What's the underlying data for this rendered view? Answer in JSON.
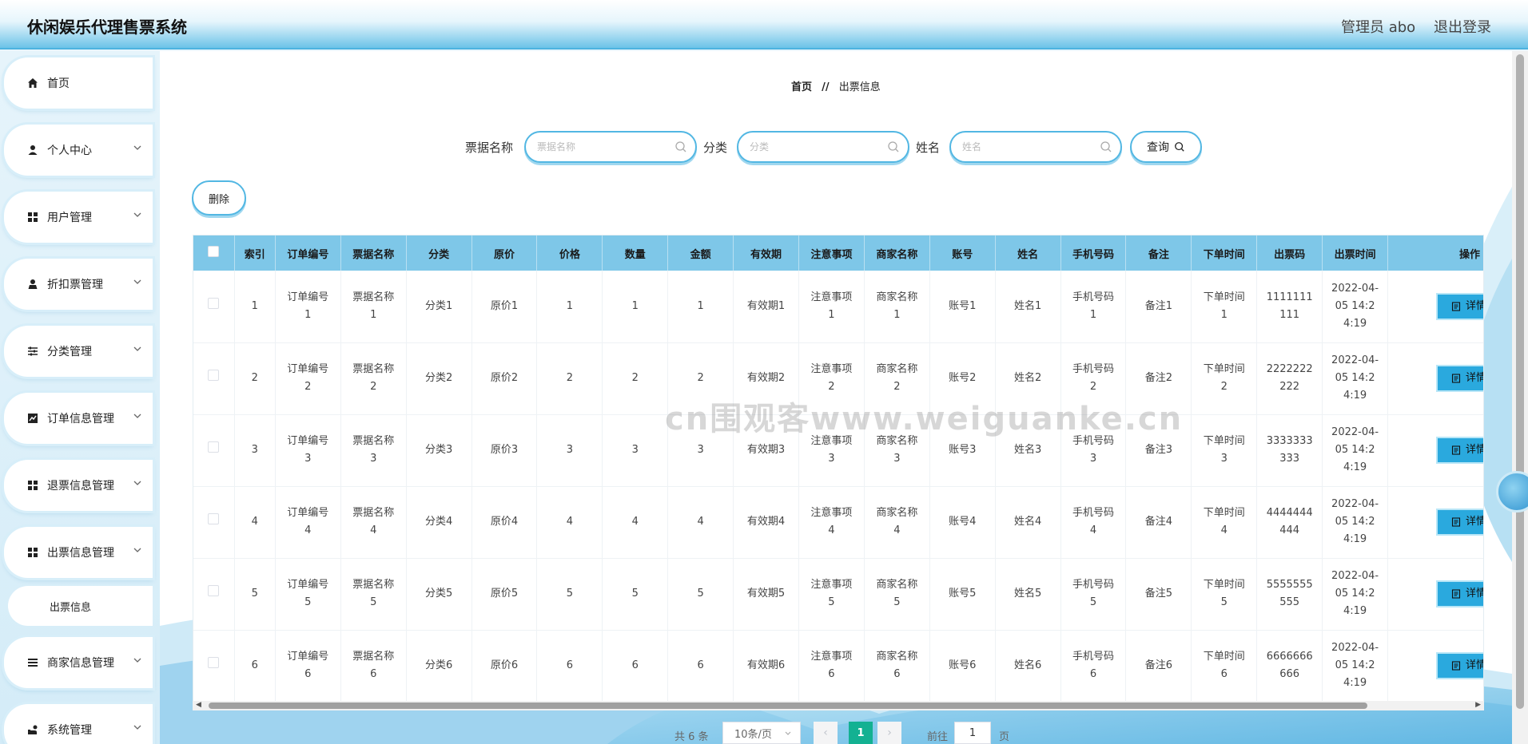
{
  "header": {
    "title": "休闲娱乐代理售票系统",
    "admin": "管理员 abo",
    "logout": "退出登录"
  },
  "sidebar": {
    "items": [
      {
        "label": "首页",
        "icon": "home-icon"
      },
      {
        "label": "个人中心",
        "icon": "user-icon"
      },
      {
        "label": "用户管理",
        "icon": "grid-icon"
      },
      {
        "label": "折扣票管理",
        "icon": "user-tie-icon"
      },
      {
        "label": "分类管理",
        "icon": "sliders-icon"
      },
      {
        "label": "订单信息管理",
        "icon": "chart-icon"
      },
      {
        "label": "退票信息管理",
        "icon": "grid-icon"
      },
      {
        "label": "出票信息管理",
        "icon": "grid-icon"
      },
      {
        "label": "商家信息管理",
        "icon": "list-icon"
      },
      {
        "label": "系统管理",
        "icon": "settings-hand-icon"
      }
    ],
    "submenu": {
      "label": "出票信息"
    }
  },
  "breadcrumb": {
    "home": "首页",
    "separator": "//",
    "current": "出票信息"
  },
  "search": {
    "ticket_label": "票据名称",
    "ticket_placeholder": "票据名称",
    "category_label": "分类",
    "category_placeholder": "分类",
    "name_label": "姓名",
    "name_placeholder": "姓名",
    "query_label": "查询"
  },
  "actions": {
    "delete_label": "删除",
    "detail_label": "详情"
  },
  "table": {
    "columns": [
      "索引",
      "订单编号",
      "票据名称",
      "分类",
      "原价",
      "价格",
      "数量",
      "金额",
      "有效期",
      "注意事项",
      "商家名称",
      "账号",
      "姓名",
      "手机号码",
      "备注",
      "下单时间",
      "出票码",
      "出票时间",
      "操作"
    ],
    "rows": [
      [
        "1",
        "订单编号1",
        "票据名称1",
        "分类1",
        "原价1",
        "1",
        "1",
        "1",
        "有效期1",
        "注意事项1",
        "商家名称1",
        "账号1",
        "姓名1",
        "手机号码1",
        "备注1",
        "下单时间1",
        "1111111111",
        "2022-04-05 14:24:19"
      ],
      [
        "2",
        "订单编号2",
        "票据名称2",
        "分类2",
        "原价2",
        "2",
        "2",
        "2",
        "有效期2",
        "注意事项2",
        "商家名称2",
        "账号2",
        "姓名2",
        "手机号码2",
        "备注2",
        "下单时间2",
        "2222222222",
        "2022-04-05 14:24:19"
      ],
      [
        "3",
        "订单编号3",
        "票据名称3",
        "分类3",
        "原价3",
        "3",
        "3",
        "3",
        "有效期3",
        "注意事项3",
        "商家名称3",
        "账号3",
        "姓名3",
        "手机号码3",
        "备注3",
        "下单时间3",
        "3333333333",
        "2022-04-05 14:24:19"
      ],
      [
        "4",
        "订单编号4",
        "票据名称4",
        "分类4",
        "原价4",
        "4",
        "4",
        "4",
        "有效期4",
        "注意事项4",
        "商家名称4",
        "账号4",
        "姓名4",
        "手机号码4",
        "备注4",
        "下单时间4",
        "4444444444",
        "2022-04-05 14:24:19"
      ],
      [
        "5",
        "订单编号5",
        "票据名称5",
        "分类5",
        "原价5",
        "5",
        "5",
        "5",
        "有效期5",
        "注意事项5",
        "商家名称5",
        "账号5",
        "姓名5",
        "手机号码5",
        "备注5",
        "下单时间5",
        "5555555555",
        "2022-04-05 14:24:19"
      ],
      [
        "6",
        "订单编号6",
        "票据名称6",
        "分类6",
        "原价6",
        "6",
        "6",
        "6",
        "有效期6",
        "注意事项6",
        "商家名称6",
        "账号6",
        "姓名6",
        "手机号码6",
        "备注6",
        "下单时间6",
        "6666666666",
        "2022-04-05 14:24:19"
      ]
    ]
  },
  "pagination": {
    "total": "共 6 条",
    "page_size": "10条/页",
    "current_page": "1",
    "goto_label": "前往",
    "goto_value": "1",
    "unit": "页"
  },
  "watermark": "cn围观客www.weiguanke.cn",
  "colors": {
    "accent": "#52b7e3",
    "header_row": "#7ec7e8",
    "detail_button": "#2aa9de",
    "current_page": "#13b192"
  }
}
